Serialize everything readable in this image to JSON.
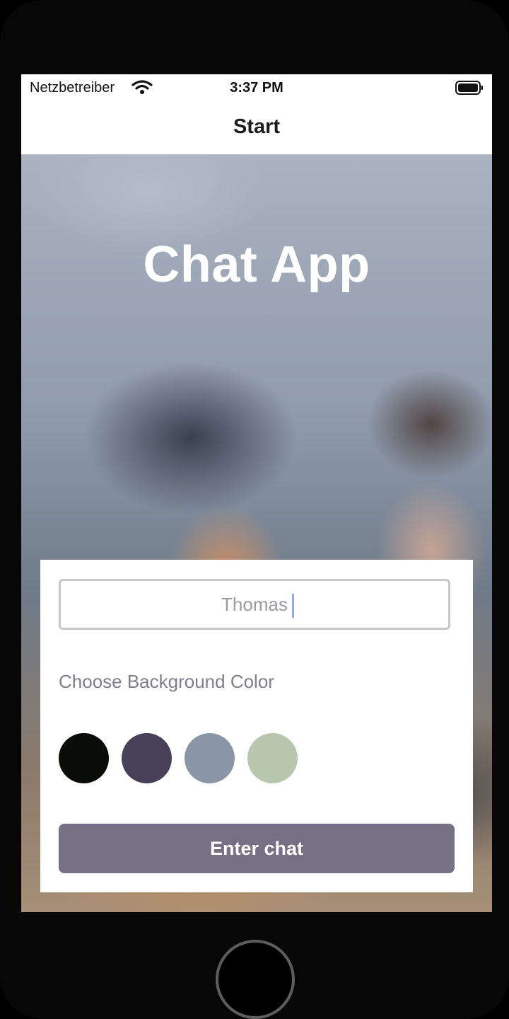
{
  "status_bar": {
    "carrier": "Netzbetreiber",
    "time": "3:37 PM"
  },
  "nav": {
    "title": "Start"
  },
  "hero": {
    "title": "Chat App"
  },
  "form": {
    "name_value": "Thomas",
    "color_label": "Choose Background Color",
    "colors": [
      {
        "name": "black",
        "hex": "#090C08"
      },
      {
        "name": "purple",
        "hex": "#474056"
      },
      {
        "name": "grey-blue",
        "hex": "#8A95A5"
      },
      {
        "name": "green",
        "hex": "#B9C6AE"
      }
    ],
    "enter_label": "Enter chat",
    "enter_button_color": "#757083"
  }
}
